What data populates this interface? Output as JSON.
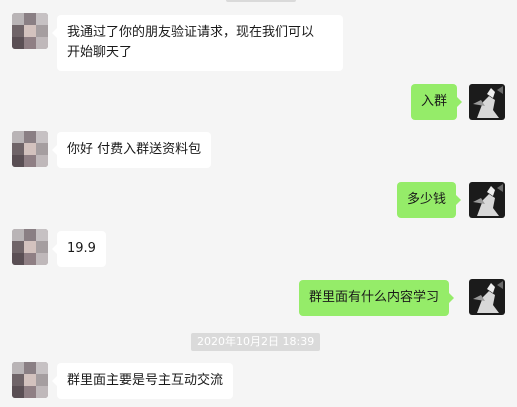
{
  "messages": [
    {
      "from": "contact",
      "lines": [
        "我通过了你的朋友验证请求，现在我们可以",
        "开始聊天了"
      ]
    },
    {
      "from": "me",
      "text": "入群"
    },
    {
      "from": "contact",
      "text": "你好 付费入群送资料包"
    },
    {
      "from": "me",
      "text": "多少钱"
    },
    {
      "from": "contact",
      "text": "19.9"
    },
    {
      "from": "me",
      "text": "群里面有什么内容学习"
    },
    {
      "from": "contact",
      "text": "群里面主要是号主互动交流"
    }
  ],
  "timestamp": "2020年10月2日  18:39",
  "colors": {
    "background": "#f5f5f5",
    "incoming_bubble": "#ffffff",
    "outgoing_bubble": "#95ec69",
    "timestamp_bg": "#dadada"
  }
}
